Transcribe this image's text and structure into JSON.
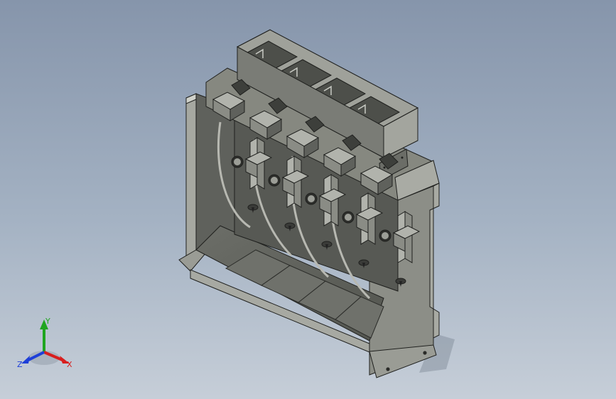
{
  "viewport": {
    "background_top": "#8695ab",
    "background_bottom": "#c6ced8"
  },
  "model": {
    "face_dark": "#5f615c",
    "face_mid": "#8a8c85",
    "face_light": "#b1b3ac",
    "edge": "#1f201e",
    "hose": "#b8b8b2",
    "stations": 5
  },
  "triad": {
    "x_label": "X",
    "y_label": "Y",
    "z_label": "Z",
    "x_color": "#d81e1e",
    "y_color": "#1fa51f",
    "z_color": "#1e3fd8"
  }
}
